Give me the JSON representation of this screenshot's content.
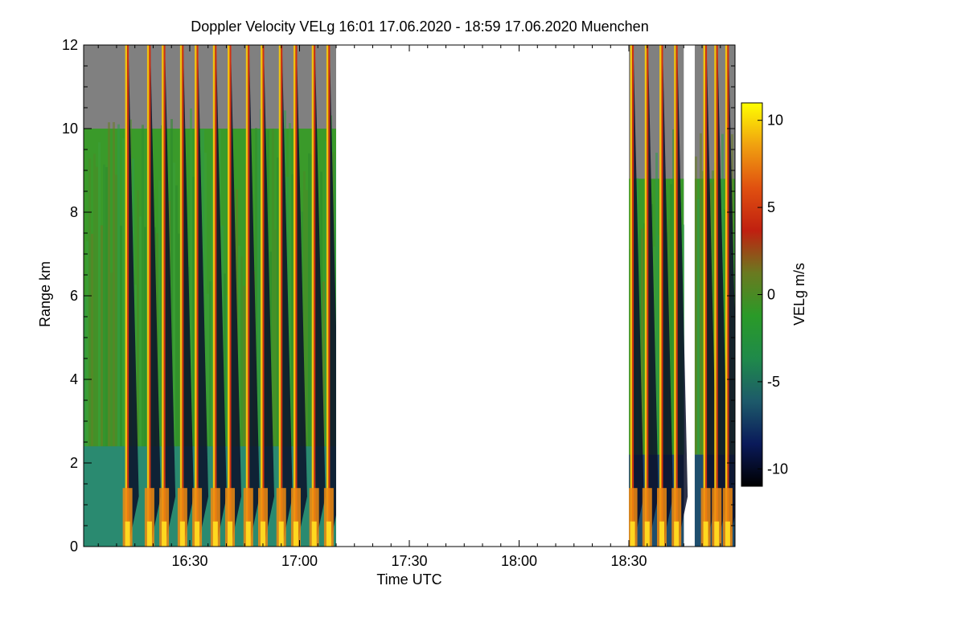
{
  "chart_data": {
    "type": "heatmap",
    "title": "Doppler Velocity VELg   16:01 17.06.2020 - 18:59 17.06.2020 Muenchen",
    "xlabel": "Time UTC",
    "ylabel": "Range km",
    "colorbar_label": "VELg m/s",
    "x_range": [
      "16:01",
      "18:59"
    ],
    "x_ticks": [
      "16:30",
      "17:00",
      "17:30",
      "18:00",
      "18:30"
    ],
    "y_range": [
      0,
      12
    ],
    "y_ticks": [
      "0",
      "2",
      "4",
      "6",
      "8",
      "10",
      "12"
    ],
    "color_range": [
      -11,
      11
    ],
    "colorbar_ticks": [
      "10",
      "5",
      "0",
      "-5",
      "-10"
    ],
    "colorbar_tick_values": [
      10,
      5,
      0,
      -5,
      -10
    ],
    "colormap": [
      "#000000",
      "#0a1a5a",
      "#1d5a6a",
      "#1f8a4a",
      "#2a9a28",
      "#6a7a20",
      "#c02010",
      "#e05010",
      "#f0a010",
      "#ffff00"
    ],
    "no_data_color": "#808080",
    "data_segments": [
      {
        "start": "16:01",
        "end": "17:10"
      },
      {
        "start": "18:30",
        "end": "18:45"
      },
      {
        "start": "18:48",
        "end": "18:59"
      }
    ],
    "data_gap": {
      "start": "17:10",
      "end": "18:30"
    },
    "fall_streak_times": [
      "16:13",
      "16:19",
      "16:23",
      "16:28",
      "16:32",
      "16:37",
      "16:41",
      "16:46",
      "16:50",
      "16:55",
      "16:59",
      "17:04",
      "17:08",
      "18:31",
      "18:35",
      "18:39",
      "18:43",
      "18:51",
      "18:54",
      "18:57"
    ],
    "low_level_layer_top_km": {
      "segment_1": 2.4,
      "segment_2": 2.2
    }
  }
}
